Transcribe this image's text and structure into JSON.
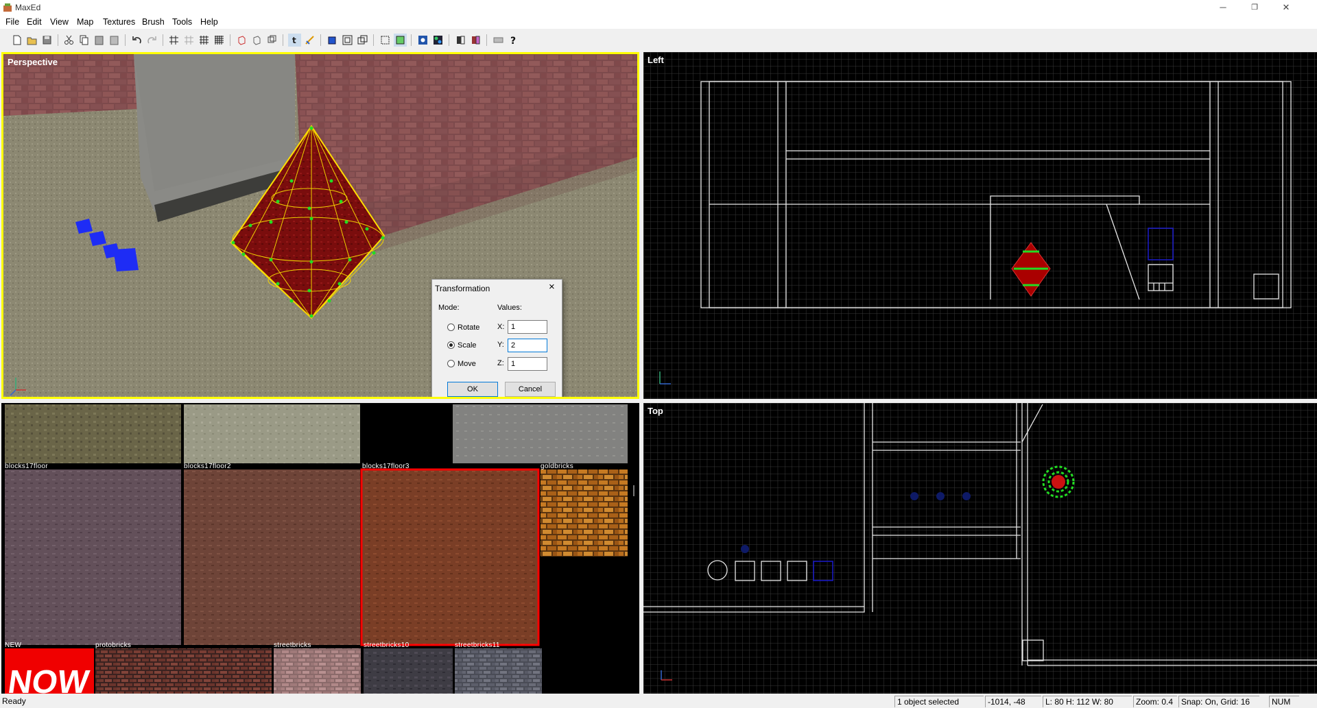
{
  "window": {
    "title": "MaxEd",
    "minimize": "─",
    "maximize": "❐",
    "close": "✕"
  },
  "menu": [
    "File",
    "Edit",
    "View",
    "Map",
    "Textures",
    "Brush",
    "Tools",
    "Help"
  ],
  "viewports": {
    "perspective": "Perspective",
    "left": "Left",
    "top": "Top"
  },
  "dialog": {
    "title": "Transformation",
    "mode_label": "Mode:",
    "values_label": "Values:",
    "modes": [
      "Rotate",
      "Scale",
      "Move"
    ],
    "selected_mode": "Scale",
    "x_label": "X:",
    "y_label": "Y:",
    "z_label": "Z:",
    "x": "1",
    "y": "2",
    "z": "1",
    "ok": "OK",
    "cancel": "Cancel"
  },
  "textures": {
    "row1": [
      "",
      "",
      "",
      ""
    ],
    "row2": [
      "blocks17floor",
      "blocks17floor2",
      "blocks17floor3",
      "goldbricks"
    ],
    "row3": [
      "NEW",
      "protobricks",
      "streetbricks",
      "streetbricks10",
      "streetbricks11"
    ],
    "new_text": "NOW",
    "selected": "blocks17floor3"
  },
  "status": {
    "ready": "Ready",
    "selection": "1 object selected",
    "coords": "-1014, -48",
    "size": "L: 80 H: 112 W: 80",
    "zoom": "Zoom: 0.4",
    "snap": "Snap: On, Grid: 16",
    "num": "NUM"
  },
  "colors": {
    "accent_selected": "#ffff00",
    "selected_texture_border": "#ff0000"
  }
}
